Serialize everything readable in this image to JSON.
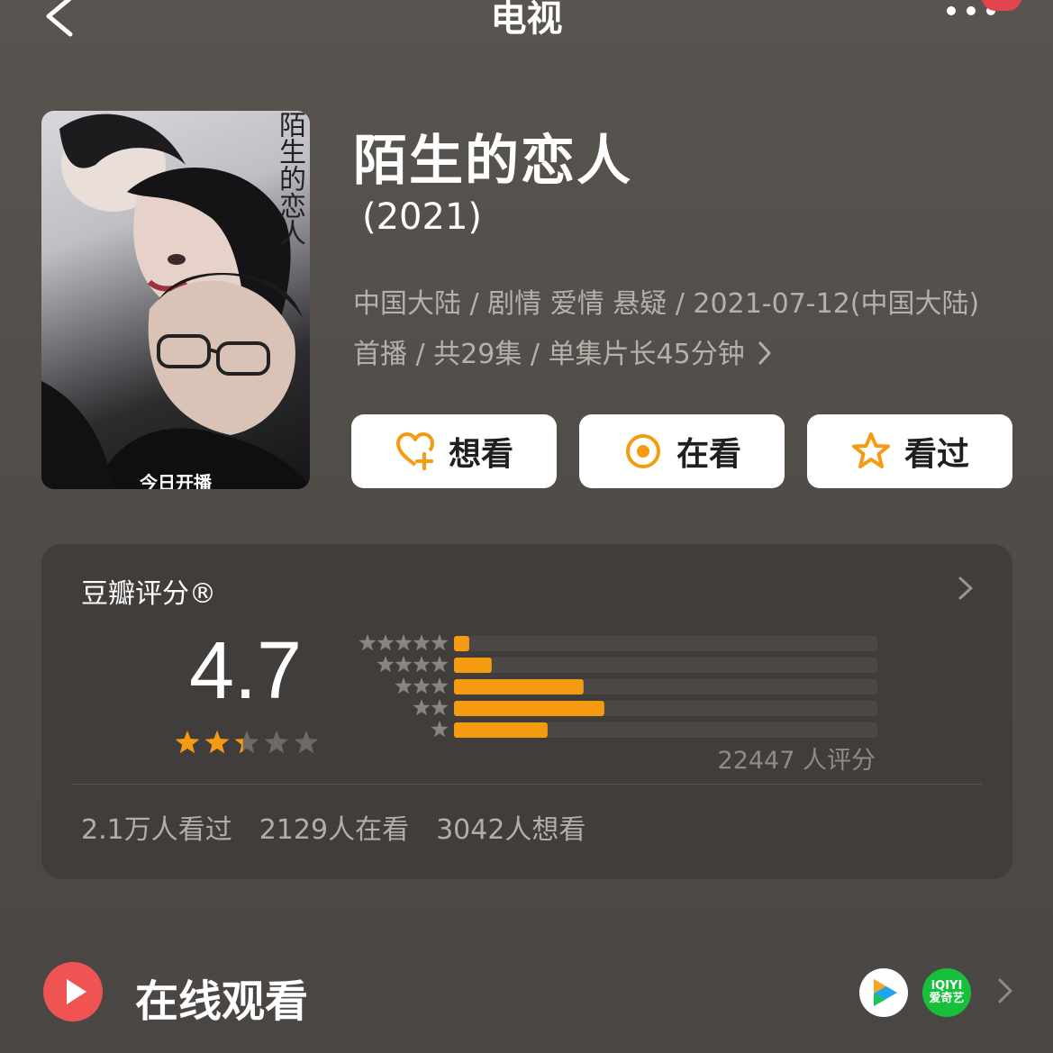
{
  "header": {
    "title": "电视",
    "back_icon": "chevron-left-icon",
    "more_icon": "more-dots-icon"
  },
  "poster": {
    "title_text": "陌生的恋人",
    "banner_text": "今日开播"
  },
  "movie": {
    "title": "陌生的恋人",
    "year": "(2021)",
    "meta": "中国大陆 / 剧情 爱情 悬疑 / 2021-07-12(中国大陆) 首播 / 共29集 / 单集片长45分钟"
  },
  "actions": {
    "wish_label": "想看",
    "watching_label": "在看",
    "watched_label": "看过"
  },
  "rating": {
    "card_title": "豆瓣评分®",
    "score": "4.7",
    "stars_out_of_5": 2.35,
    "distribution": [
      {
        "stars": 5,
        "percent": 3.6
      },
      {
        "stars": 4,
        "percent": 8.9
      },
      {
        "stars": 3,
        "percent": 30.6
      },
      {
        "stars": 2,
        "percent": 35.5
      },
      {
        "stars": 1,
        "percent": 22.1
      }
    ],
    "raters": "22447 人评分",
    "stats": {
      "watched": "2.1万人看过",
      "watching": "2129人在看",
      "wish": "3042人想看"
    }
  },
  "online": {
    "title": "在线观看",
    "platforms": [
      "tencent-video-icon",
      "iqiyi-icon"
    ],
    "iqiyi_text_top": "iQIYI",
    "iqiyi_text_bottom": "爱奇艺"
  },
  "colors": {
    "accent_orange": "#f59b12",
    "play_red": "#ef5352"
  }
}
